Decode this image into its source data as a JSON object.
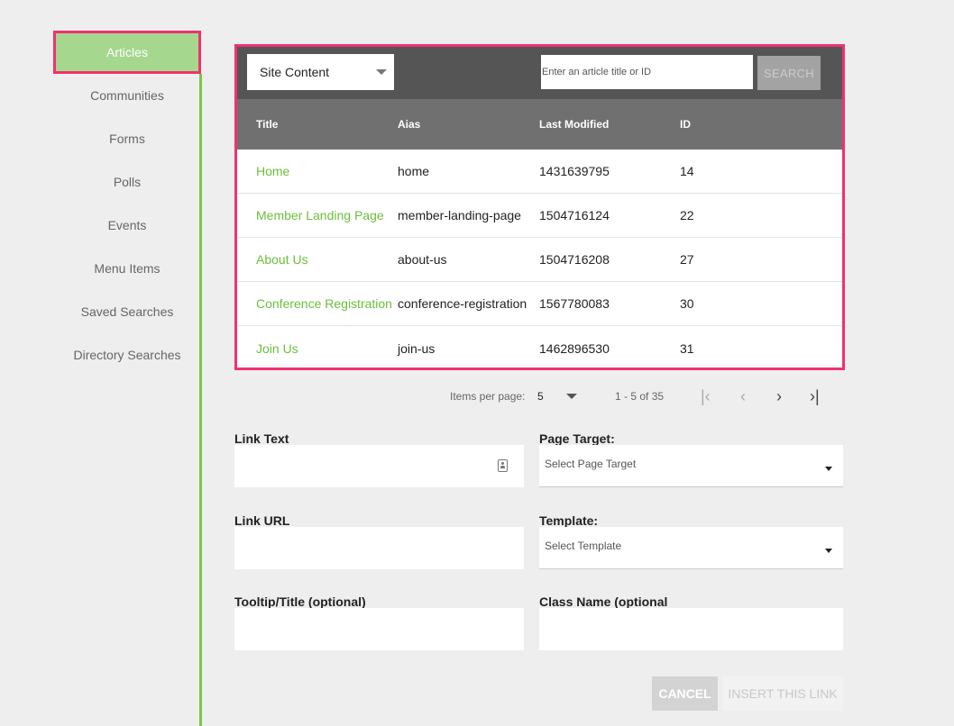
{
  "sidebar": {
    "items": [
      {
        "label": "Articles",
        "active": true
      },
      {
        "label": "Communities"
      },
      {
        "label": "Forms"
      },
      {
        "label": "Polls"
      },
      {
        "label": "Events"
      },
      {
        "label": "Menu Items"
      },
      {
        "label": "Saved Searches"
      },
      {
        "label": "Directory Searches"
      }
    ]
  },
  "toolbar": {
    "content_select": "Site Content",
    "search_placeholder": "Enter an article title or ID",
    "search_label": "SEARCH"
  },
  "table": {
    "headers": [
      "Title",
      "Aias",
      "Last Modified",
      "ID"
    ],
    "rows": [
      {
        "title": "Home",
        "alias": "home",
        "modified": "1431639795",
        "id": "14"
      },
      {
        "title": "Member Landing Page",
        "alias": "member-landing-page",
        "modified": "1504716124",
        "id": "22"
      },
      {
        "title": "About Us",
        "alias": "about-us",
        "modified": "1504716208",
        "id": "27"
      },
      {
        "title": "Conference Registration",
        "alias": "conference-registration",
        "modified": "1567780083",
        "id": "30"
      },
      {
        "title": "Join Us",
        "alias": "join-us",
        "modified": "1462896530",
        "id": "31"
      }
    ]
  },
  "pager": {
    "items_label": "Items per page:",
    "items_value": "5",
    "range": "1 - 5 of 35"
  },
  "form": {
    "link_text_label": "Link Text",
    "page_target_label": "Page Target:",
    "page_target_placeholder": "Select Page Target",
    "link_url_label": "Link URL",
    "template_label": "Template:",
    "template_placeholder": "Select Template",
    "tooltip_label": "Tooltip/Title (optional)",
    "class_label": "Class Name (optional"
  },
  "buttons": {
    "cancel": "CANCEL",
    "insert": "INSERT THIS LINK"
  },
  "colors": {
    "accent_green": "#6bbf3a",
    "highlight_pink": "#f0326e"
  }
}
